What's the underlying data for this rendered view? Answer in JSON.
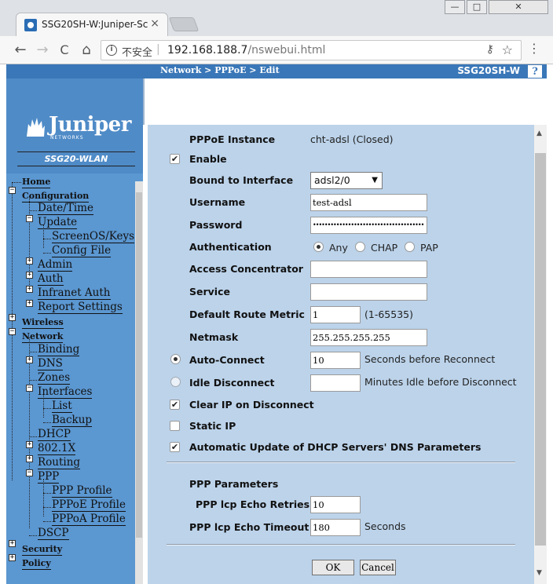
{
  "browser": {
    "tab_title": "SSG20SH-W:Juniper-Sc",
    "tab_close": "×",
    "back": "←",
    "forward": "→",
    "reload": "C",
    "home": "⌂",
    "insecure_label": "不安全",
    "url_host": "192.168.188.7",
    "url_path": "/nswebui.html",
    "window_min": "—",
    "window_max": "□",
    "window_close": "✕"
  },
  "header": {
    "breadcrumb": "Network > PPPoE > Edit",
    "device": "SSG20SH-W",
    "help": "?"
  },
  "sidebar": {
    "logo_text": "Juniper",
    "logo_sub": "NETWORKS",
    "model": "SSG20-WLAN",
    "tree": {
      "home": "Home",
      "configuration": "Configuration",
      "datetime": "Date/Time",
      "update": "Update",
      "screenos": "ScreenOS/Keys",
      "config_file": "Config File",
      "admin": "Admin",
      "auth": "Auth",
      "infranet": "Infranet Auth",
      "report": "Report Settings",
      "wireless": "Wireless",
      "network": "Network",
      "binding": "Binding",
      "dns": "DNS",
      "zones": "Zones",
      "interfaces": "Interfaces",
      "list": "List",
      "backup": "Backup",
      "dhcp": "DHCP",
      "dot1x": "802.1X",
      "routing": "Routing",
      "ppp": "PPP",
      "ppp_profile": "PPP Profile",
      "pppoe_profile": "PPPoE Profile",
      "pppoa_profile": "PPPoA Profile",
      "dscp": "DSCP",
      "security": "Security",
      "policy": "Policy"
    }
  },
  "form": {
    "instance_label": "PPPoE Instance",
    "instance_value": "cht-adsl (Closed)",
    "enable_label": "Enable",
    "bound_label": "Bound to Interface",
    "bound_value": "adsl2/0",
    "username_label": "Username",
    "username_value": "test-adsl",
    "password_label": "Password",
    "password_value": "••••••••••••••••••••••••••••••••••••••",
    "auth_label": "Authentication",
    "auth_options": [
      "Any",
      "CHAP",
      "PAP"
    ],
    "auth_selected": "Any",
    "ac_label": "Access Concentrator",
    "ac_value": "",
    "service_label": "Service",
    "service_value": "",
    "metric_label": "Default Route Metric",
    "metric_value": "1",
    "metric_range": "(1-65535)",
    "netmask_label": "Netmask",
    "netmask_value": "255.255.255.255",
    "autoconnect_label": "Auto-Connect",
    "autoconnect_value": "10",
    "autoconnect_suffix": "Seconds before Reconnect",
    "idle_label": "Idle Disconnect",
    "idle_value": "",
    "idle_suffix": "Minutes Idle before Disconnect",
    "clearip_label": "Clear IP on Disconnect",
    "staticip_label": "Static IP",
    "autoupdate_label": "Automatic Update of DHCP Servers' DNS Parameters",
    "ppp_params_label": "PPP Parameters",
    "lcp_retries_label": "PPP lcp Echo Retries",
    "lcp_retries_value": "10",
    "lcp_timeout_label": "PPP lcp Echo Timeout",
    "lcp_timeout_value": "180",
    "lcp_timeout_suffix": "Seconds",
    "ok_label": "OK",
    "cancel_label": "Cancel",
    "check_mark": "✔"
  }
}
